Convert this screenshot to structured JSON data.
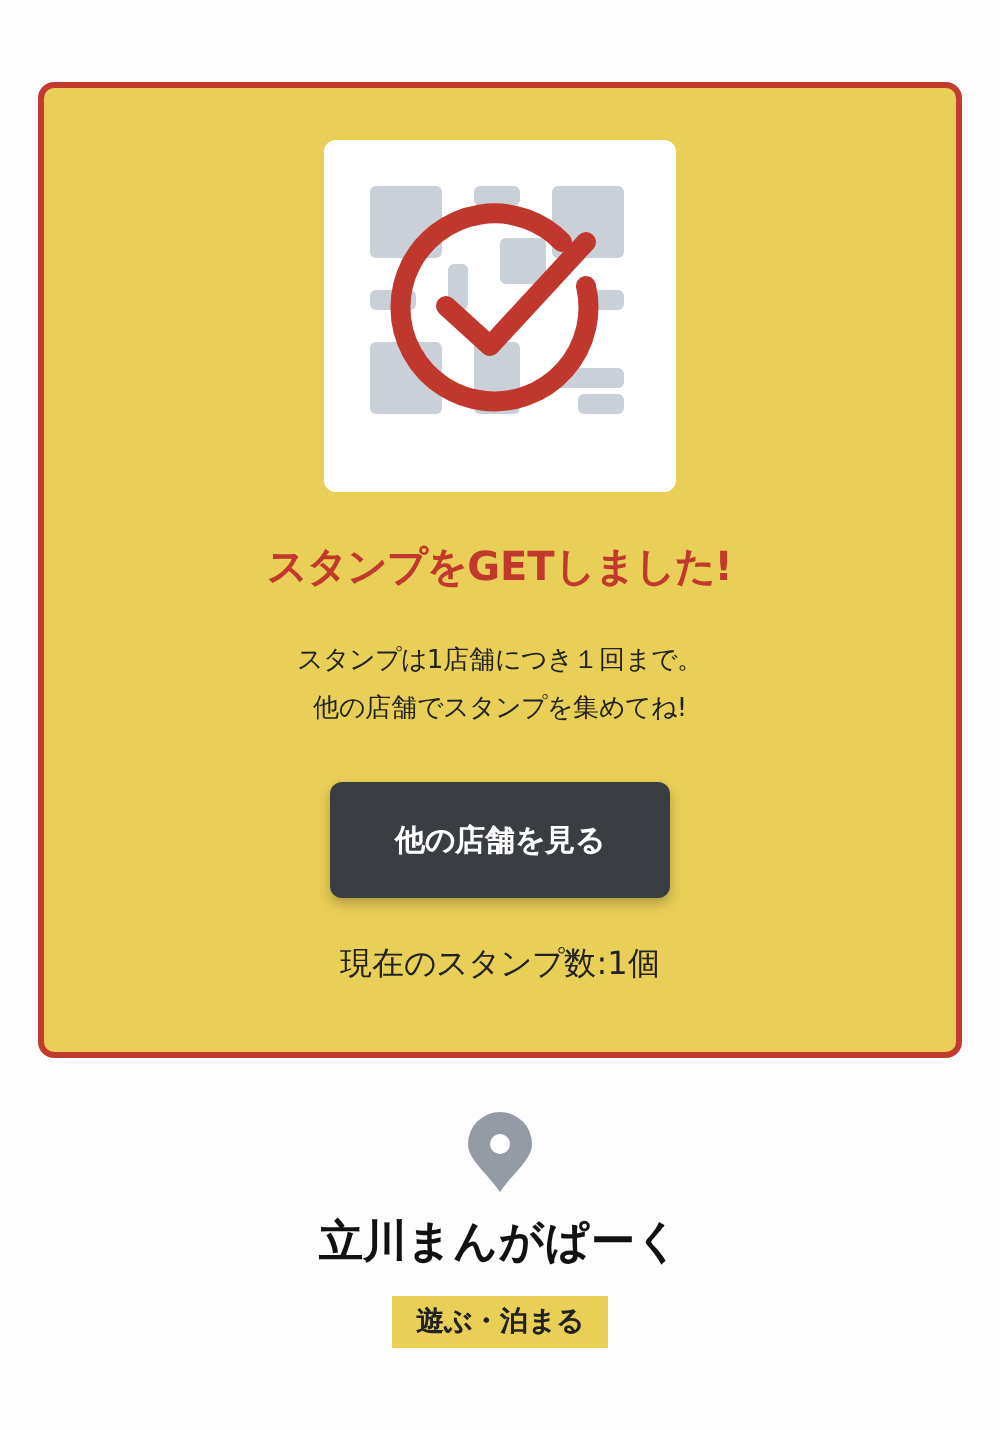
{
  "stamp_card": {
    "title": "スタンプをGETしました!",
    "message": [
      "スタンプは1店舗につき１回まで。",
      "他の店舗でスタンプを集めてね!"
    ],
    "button": "他の店舗を見る",
    "count": "現在のスタンプ数:1個"
  },
  "shop": {
    "name": "立川まんがぱーく",
    "tag": "遊ぶ・泊まる"
  }
}
